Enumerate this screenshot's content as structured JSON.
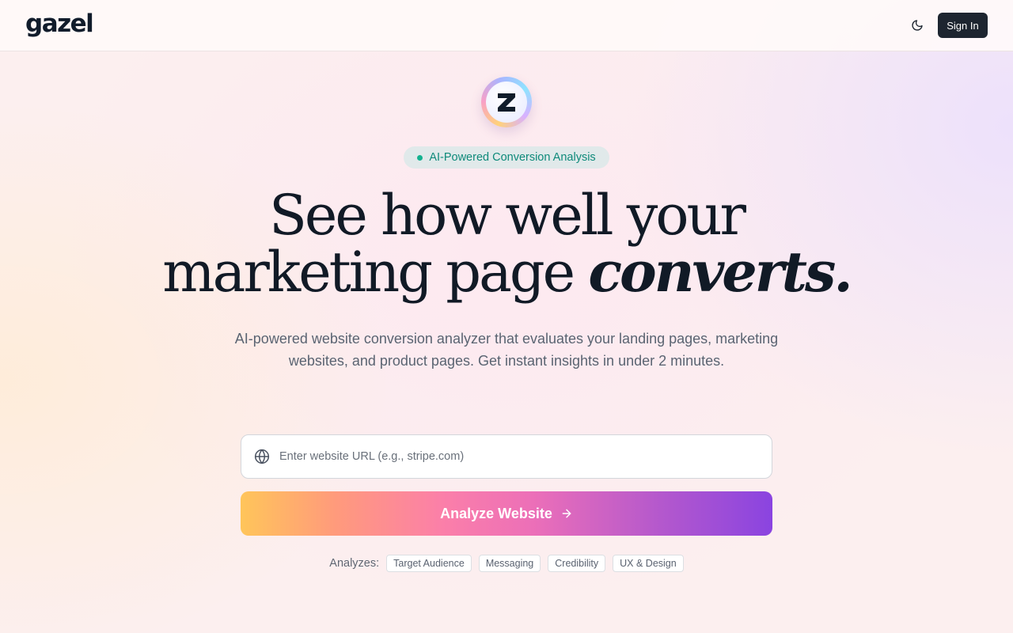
{
  "header": {
    "logo": "gazel",
    "theme_toggle_icon": "moon-icon",
    "signin_label": "Sign In"
  },
  "hero": {
    "mascot_letter": "Z",
    "badge": "AI-Powered Conversion Analysis",
    "headline_line1": "See how well your",
    "headline_line2_plain": "marketing page",
    "headline_line2_emphasis": "converts.",
    "subtitle": "AI-powered website conversion analyzer that evaluates your landing pages, marketing websites, and product pages. Get instant insights in under 2 minutes."
  },
  "form": {
    "url_icon": "globe-icon",
    "url_value": "",
    "url_placeholder": "Enter website URL (e.g., stripe.com)",
    "analyze_label": "Analyze Website",
    "analyze_icon": "arrow-right-icon"
  },
  "analyzes": {
    "label": "Analyzes:",
    "items": [
      "Target Audience",
      "Messaging",
      "Credibility",
      "UX & Design"
    ]
  },
  "colors": {
    "badge_text": "#0e8a7a",
    "button_gradient": [
      "#ffc55a",
      "#fb7fa9",
      "#8a44e0"
    ],
    "signin_bg": "#1d2530"
  }
}
